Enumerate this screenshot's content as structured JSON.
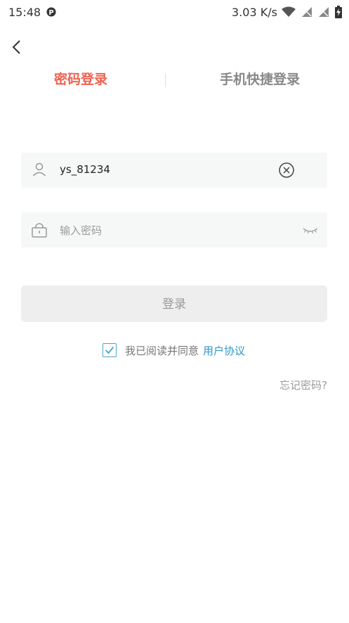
{
  "status_bar": {
    "time": "15:48",
    "network_speed": "3.03 K/s",
    "icons": [
      "parking-icon",
      "wifi-icon",
      "signal-off-icon",
      "signal-off-icon",
      "battery-charging-icon"
    ]
  },
  "nav": {
    "back_icon": "chevron-left-icon"
  },
  "tabs": {
    "password_login": "密码登录",
    "quick_login": "手机快捷登录"
  },
  "form": {
    "username": {
      "value": "ys_81234",
      "icon": "user-icon",
      "clear_icon": "clear-circle-icon"
    },
    "password": {
      "placeholder": "输入密码",
      "icon": "lock-icon",
      "toggle_icon": "eye-closed-icon"
    },
    "login_label": "登录"
  },
  "agreement": {
    "checked": true,
    "text": "我已阅读并同意",
    "link": "用户协议"
  },
  "forgot_password": "忘记密码?",
  "colors": {
    "accent": "#f0624f",
    "link": "#2d98c7",
    "field_bg": "#f6f8f7",
    "button_bg": "#eeeeee"
  }
}
